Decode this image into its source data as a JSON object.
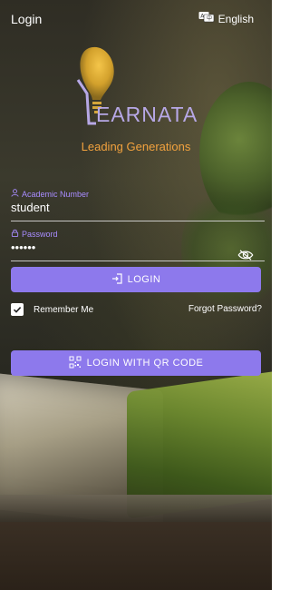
{
  "header": {
    "title": "Login",
    "language_label": "English"
  },
  "branding": {
    "logo_text": "EARNATA",
    "tagline": "Leading Generations"
  },
  "form": {
    "academic_label": "Academic Number",
    "academic_value": "student",
    "password_label": "Password",
    "password_value": "••••••"
  },
  "actions": {
    "login_label": "LOGIN",
    "remember_label": "Remember Me",
    "remember_checked": true,
    "forgot_label": "Forgot Password?",
    "qr_label": "LOGIN WITH QR CODE"
  },
  "colors": {
    "accent": "#8d79ec",
    "label": "#a88cff",
    "tagline": "#f2a23e",
    "logo_text": "#b7a8e6"
  }
}
